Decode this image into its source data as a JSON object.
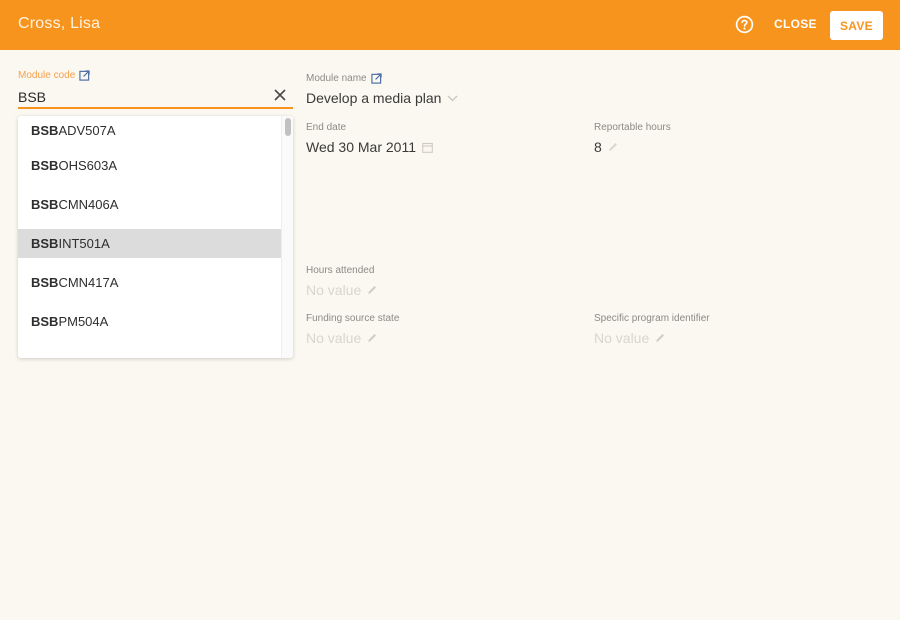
{
  "header": {
    "title": "Cross, Lisa",
    "help_icon": "help-circle-icon",
    "close_label": "CLOSE",
    "save_label": "SAVE"
  },
  "colors": {
    "accent": "#f7941d",
    "background": "#fbf8f1",
    "highlight": "#dcdcdc"
  },
  "fields": {
    "module_code": {
      "label": "Module code",
      "value": "BSB",
      "icon": "external-link-icon"
    },
    "module_name": {
      "label": "Module name",
      "value": "Develop a media plan",
      "icon": "external-link-icon"
    },
    "end_date": {
      "label": "End date",
      "value": "Wed 30 Mar 2011"
    },
    "reportable_hours": {
      "label": "Reportable hours",
      "value": "8"
    },
    "hours_attended": {
      "label": "Hours attended",
      "value": "No value"
    },
    "funding_source_state": {
      "label": "Funding source state",
      "value": "No value"
    },
    "specific_program_identifier": {
      "label": "Specific program identifier",
      "value": "No value"
    }
  },
  "dropdown": {
    "match": "BSB",
    "highlighted_index": 3,
    "items": [
      {
        "prefix": "BSB",
        "suffix": "ADV507A"
      },
      {
        "prefix": "BSB",
        "suffix": "OHS603A"
      },
      {
        "prefix": "BSB",
        "suffix": "CMN406A"
      },
      {
        "prefix": "BSB",
        "suffix": "INT501A"
      },
      {
        "prefix": "BSB",
        "suffix": "CMN417A"
      },
      {
        "prefix": "BSB",
        "suffix": "PM504A"
      }
    ]
  }
}
